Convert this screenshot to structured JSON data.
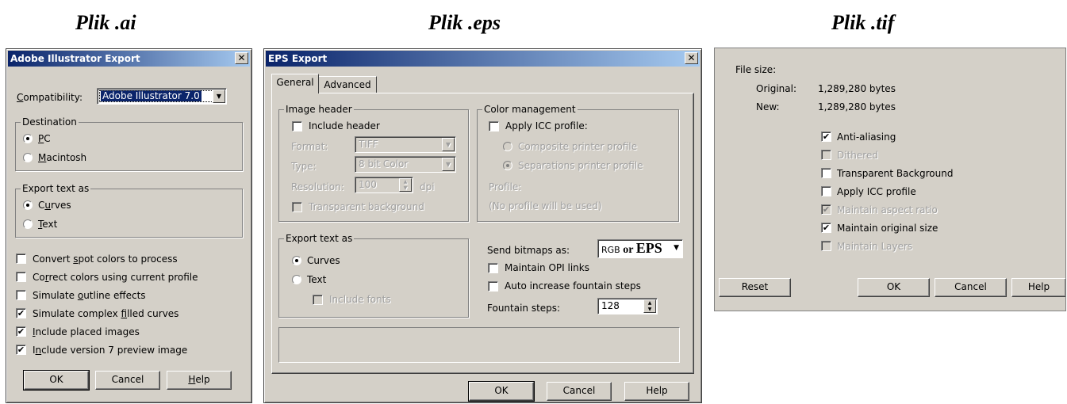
{
  "headings": {
    "ai": "Plik .ai",
    "eps": "Plik .eps",
    "tif": "Plik .tif"
  },
  "ai_dialog": {
    "title": "Adobe Illustrator Export",
    "close_icon": "close-icon",
    "compatibility_label": {
      "pre": "",
      "u": "C",
      "post": "ompatibility:"
    },
    "compatibility_value": "Adobe Illustrator 7.0",
    "destination": {
      "label": "Destination",
      "options": [
        {
          "pre": "",
          "u": "P",
          "post": "C",
          "selected": true
        },
        {
          "pre": "",
          "u": "M",
          "post": "acintosh",
          "selected": false
        }
      ]
    },
    "export_text": {
      "label": "Export text as",
      "options": [
        {
          "pre": "C",
          "u": "u",
          "post": "rves",
          "selected": true
        },
        {
          "pre": "",
          "u": "T",
          "post": "ext",
          "selected": false
        }
      ]
    },
    "checkboxes": [
      {
        "pre": "Convert ",
        "u": "s",
        "post": "pot colors to process",
        "checked": false
      },
      {
        "pre": "Co",
        "u": "r",
        "post": "rect colors using current profile",
        "checked": false
      },
      {
        "pre": "Simulate ",
        "u": "o",
        "post": "utline effects",
        "checked": false
      },
      {
        "pre": "Simulate complex ",
        "u": "f",
        "post": "illed curves",
        "checked": true
      },
      {
        "pre": "",
        "u": "I",
        "post": "nclude placed images",
        "checked": true
      },
      {
        "pre": "I",
        "u": "n",
        "post": "clude version 7 preview image",
        "checked": true
      }
    ],
    "buttons": {
      "ok": "OK",
      "cancel": "Cancel",
      "help": {
        "pre": "",
        "u": "H",
        "post": "elp"
      }
    }
  },
  "eps_dialog": {
    "title": "EPS Export",
    "close_icon": "close-icon",
    "tabs": [
      "General",
      "Advanced"
    ],
    "image_header": {
      "label": "Image header",
      "include_header": "Include header",
      "format_label": "Format:",
      "format_value": "TIFF",
      "type_label": "Type:",
      "type_value": "8 bit Color",
      "resolution_label": "Resolution:",
      "resolution_value": "100",
      "resolution_unit": "dpi",
      "transparent_bg": "Transparent background"
    },
    "color_management": {
      "label": "Color management",
      "apply_icc": "Apply ICC profile:",
      "composite": "Composite printer profile",
      "separations": "Separations printer profile",
      "profile_label": "Profile:",
      "profile_value": "(No profile will be used)"
    },
    "export_text": {
      "label": "Export text as",
      "curves": "Curves",
      "text": "Text",
      "include_fonts": "Include fonts"
    },
    "send_bitmaps_label": "Send bitmaps as:",
    "send_bitmaps_value_small": "RGB",
    "send_bitmaps_value_or": "or",
    "send_bitmaps_value_big": "EPS",
    "maintain_opi": "Maintain OPI links",
    "auto_fountain": "Auto increase fountain steps",
    "fountain_label": "Fountain steps:",
    "fountain_value": "128",
    "buttons": {
      "ok": "OK",
      "cancel": "Cancel",
      "help": "Help"
    }
  },
  "tif_dialog": {
    "file_size_label": "File size:",
    "original_label": "Original:",
    "original_value": "1,289,280 bytes",
    "new_label": "New:",
    "new_value": "1,289,280 bytes",
    "checkboxes": [
      {
        "label": "Anti-aliasing",
        "checked": true,
        "disabled": false
      },
      {
        "label": "Dithered",
        "checked": false,
        "disabled": true
      },
      {
        "label": "Transparent Background",
        "checked": false,
        "disabled": false
      },
      {
        "label": "Apply ICC profile",
        "checked": false,
        "disabled": false
      },
      {
        "label": "Maintain aspect ratio",
        "checked": true,
        "disabled": true
      },
      {
        "label": "Maintain original size",
        "checked": true,
        "disabled": false
      },
      {
        "label": "Maintain Layers",
        "checked": false,
        "disabled": true
      }
    ],
    "buttons": {
      "reset": "Reset",
      "ok": "OK",
      "cancel": "Cancel",
      "help": "Help"
    }
  }
}
